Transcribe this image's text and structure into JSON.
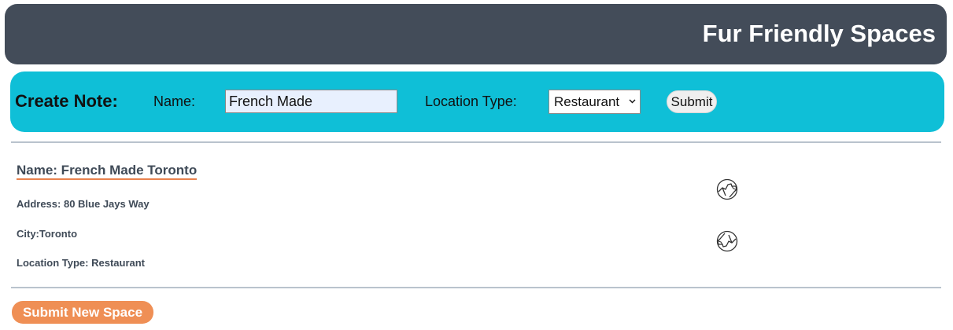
{
  "header": {
    "title": "Fur Friendly Spaces"
  },
  "create_note": {
    "title": "Create Note:",
    "name_label": "Name:",
    "name_value": "French Made",
    "location_label": "Location Type:",
    "location_selected": "Restaurant",
    "submit_label": "Submit"
  },
  "space": {
    "name": "Name: French Made Toronto",
    "address": "Address: 80 Blue Jays Way",
    "city": "City:Toronto",
    "location_type": "Location Type: Restaurant",
    "icons": [
      "thumbs-up-icon",
      "thumbs-down-icon"
    ]
  },
  "footer": {
    "submit_new_label": "Submit New Space"
  },
  "colors": {
    "header_bg": "#434c59",
    "create_bar_bg": "#0fbfd7",
    "accent_orange": "#ef8f55",
    "text_dark": "#3f4a57"
  }
}
